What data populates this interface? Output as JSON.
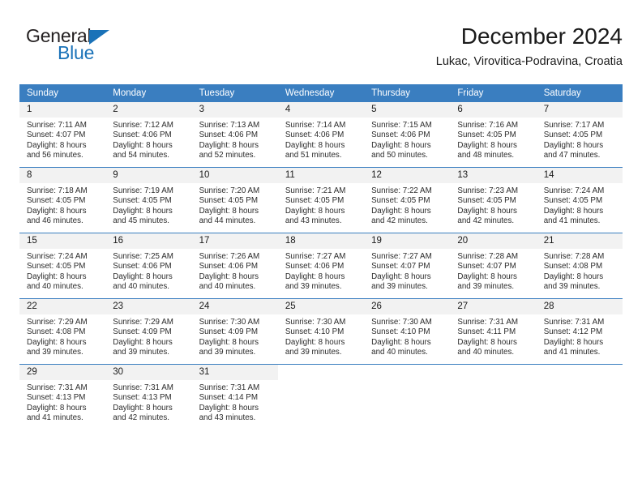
{
  "brand": {
    "name_part1": "General",
    "name_part2": "Blue",
    "triangle_color": "#1a72b8",
    "logo_icon": "general-blue-logo"
  },
  "header": {
    "title": "December 2024",
    "subtitle": "Lukac, Virovitica-Podravina, Croatia"
  },
  "theme": {
    "header_blue": "#3a7ec0",
    "daynum_gray": "#f2f2f2",
    "text": "#1a1a1a"
  },
  "weekday_headers": [
    "Sunday",
    "Monday",
    "Tuesday",
    "Wednesday",
    "Thursday",
    "Friday",
    "Saturday"
  ],
  "weeks": [
    {
      "days": [
        {
          "num": "1",
          "sunrise": "Sunrise: 7:11 AM",
          "sunset": "Sunset: 4:07 PM",
          "daylight1": "Daylight: 8 hours",
          "daylight2": "and 56 minutes."
        },
        {
          "num": "2",
          "sunrise": "Sunrise: 7:12 AM",
          "sunset": "Sunset: 4:06 PM",
          "daylight1": "Daylight: 8 hours",
          "daylight2": "and 54 minutes."
        },
        {
          "num": "3",
          "sunrise": "Sunrise: 7:13 AM",
          "sunset": "Sunset: 4:06 PM",
          "daylight1": "Daylight: 8 hours",
          "daylight2": "and 52 minutes."
        },
        {
          "num": "4",
          "sunrise": "Sunrise: 7:14 AM",
          "sunset": "Sunset: 4:06 PM",
          "daylight1": "Daylight: 8 hours",
          "daylight2": "and 51 minutes."
        },
        {
          "num": "5",
          "sunrise": "Sunrise: 7:15 AM",
          "sunset": "Sunset: 4:06 PM",
          "daylight1": "Daylight: 8 hours",
          "daylight2": "and 50 minutes."
        },
        {
          "num": "6",
          "sunrise": "Sunrise: 7:16 AM",
          "sunset": "Sunset: 4:05 PM",
          "daylight1": "Daylight: 8 hours",
          "daylight2": "and 48 minutes."
        },
        {
          "num": "7",
          "sunrise": "Sunrise: 7:17 AM",
          "sunset": "Sunset: 4:05 PM",
          "daylight1": "Daylight: 8 hours",
          "daylight2": "and 47 minutes."
        }
      ]
    },
    {
      "days": [
        {
          "num": "8",
          "sunrise": "Sunrise: 7:18 AM",
          "sunset": "Sunset: 4:05 PM",
          "daylight1": "Daylight: 8 hours",
          "daylight2": "and 46 minutes."
        },
        {
          "num": "9",
          "sunrise": "Sunrise: 7:19 AM",
          "sunset": "Sunset: 4:05 PM",
          "daylight1": "Daylight: 8 hours",
          "daylight2": "and 45 minutes."
        },
        {
          "num": "10",
          "sunrise": "Sunrise: 7:20 AM",
          "sunset": "Sunset: 4:05 PM",
          "daylight1": "Daylight: 8 hours",
          "daylight2": "and 44 minutes."
        },
        {
          "num": "11",
          "sunrise": "Sunrise: 7:21 AM",
          "sunset": "Sunset: 4:05 PM",
          "daylight1": "Daylight: 8 hours",
          "daylight2": "and 43 minutes."
        },
        {
          "num": "12",
          "sunrise": "Sunrise: 7:22 AM",
          "sunset": "Sunset: 4:05 PM",
          "daylight1": "Daylight: 8 hours",
          "daylight2": "and 42 minutes."
        },
        {
          "num": "13",
          "sunrise": "Sunrise: 7:23 AM",
          "sunset": "Sunset: 4:05 PM",
          "daylight1": "Daylight: 8 hours",
          "daylight2": "and 42 minutes."
        },
        {
          "num": "14",
          "sunrise": "Sunrise: 7:24 AM",
          "sunset": "Sunset: 4:05 PM",
          "daylight1": "Daylight: 8 hours",
          "daylight2": "and 41 minutes."
        }
      ]
    },
    {
      "days": [
        {
          "num": "15",
          "sunrise": "Sunrise: 7:24 AM",
          "sunset": "Sunset: 4:05 PM",
          "daylight1": "Daylight: 8 hours",
          "daylight2": "and 40 minutes."
        },
        {
          "num": "16",
          "sunrise": "Sunrise: 7:25 AM",
          "sunset": "Sunset: 4:06 PM",
          "daylight1": "Daylight: 8 hours",
          "daylight2": "and 40 minutes."
        },
        {
          "num": "17",
          "sunrise": "Sunrise: 7:26 AM",
          "sunset": "Sunset: 4:06 PM",
          "daylight1": "Daylight: 8 hours",
          "daylight2": "and 40 minutes."
        },
        {
          "num": "18",
          "sunrise": "Sunrise: 7:27 AM",
          "sunset": "Sunset: 4:06 PM",
          "daylight1": "Daylight: 8 hours",
          "daylight2": "and 39 minutes."
        },
        {
          "num": "19",
          "sunrise": "Sunrise: 7:27 AM",
          "sunset": "Sunset: 4:07 PM",
          "daylight1": "Daylight: 8 hours",
          "daylight2": "and 39 minutes."
        },
        {
          "num": "20",
          "sunrise": "Sunrise: 7:28 AM",
          "sunset": "Sunset: 4:07 PM",
          "daylight1": "Daylight: 8 hours",
          "daylight2": "and 39 minutes."
        },
        {
          "num": "21",
          "sunrise": "Sunrise: 7:28 AM",
          "sunset": "Sunset: 4:08 PM",
          "daylight1": "Daylight: 8 hours",
          "daylight2": "and 39 minutes."
        }
      ]
    },
    {
      "days": [
        {
          "num": "22",
          "sunrise": "Sunrise: 7:29 AM",
          "sunset": "Sunset: 4:08 PM",
          "daylight1": "Daylight: 8 hours",
          "daylight2": "and 39 minutes."
        },
        {
          "num": "23",
          "sunrise": "Sunrise: 7:29 AM",
          "sunset": "Sunset: 4:09 PM",
          "daylight1": "Daylight: 8 hours",
          "daylight2": "and 39 minutes."
        },
        {
          "num": "24",
          "sunrise": "Sunrise: 7:30 AM",
          "sunset": "Sunset: 4:09 PM",
          "daylight1": "Daylight: 8 hours",
          "daylight2": "and 39 minutes."
        },
        {
          "num": "25",
          "sunrise": "Sunrise: 7:30 AM",
          "sunset": "Sunset: 4:10 PM",
          "daylight1": "Daylight: 8 hours",
          "daylight2": "and 39 minutes."
        },
        {
          "num": "26",
          "sunrise": "Sunrise: 7:30 AM",
          "sunset": "Sunset: 4:10 PM",
          "daylight1": "Daylight: 8 hours",
          "daylight2": "and 40 minutes."
        },
        {
          "num": "27",
          "sunrise": "Sunrise: 7:31 AM",
          "sunset": "Sunset: 4:11 PM",
          "daylight1": "Daylight: 8 hours",
          "daylight2": "and 40 minutes."
        },
        {
          "num": "28",
          "sunrise": "Sunrise: 7:31 AM",
          "sunset": "Sunset: 4:12 PM",
          "daylight1": "Daylight: 8 hours",
          "daylight2": "and 41 minutes."
        }
      ]
    },
    {
      "days": [
        {
          "num": "29",
          "sunrise": "Sunrise: 7:31 AM",
          "sunset": "Sunset: 4:13 PM",
          "daylight1": "Daylight: 8 hours",
          "daylight2": "and 41 minutes."
        },
        {
          "num": "30",
          "sunrise": "Sunrise: 7:31 AM",
          "sunset": "Sunset: 4:13 PM",
          "daylight1": "Daylight: 8 hours",
          "daylight2": "and 42 minutes."
        },
        {
          "num": "31",
          "sunrise": "Sunrise: 7:31 AM",
          "sunset": "Sunset: 4:14 PM",
          "daylight1": "Daylight: 8 hours",
          "daylight2": "and 43 minutes."
        },
        {
          "num": "",
          "sunrise": "",
          "sunset": "",
          "daylight1": "",
          "daylight2": ""
        },
        {
          "num": "",
          "sunrise": "",
          "sunset": "",
          "daylight1": "",
          "daylight2": ""
        },
        {
          "num": "",
          "sunrise": "",
          "sunset": "",
          "daylight1": "",
          "daylight2": ""
        },
        {
          "num": "",
          "sunrise": "",
          "sunset": "",
          "daylight1": "",
          "daylight2": ""
        }
      ]
    }
  ]
}
